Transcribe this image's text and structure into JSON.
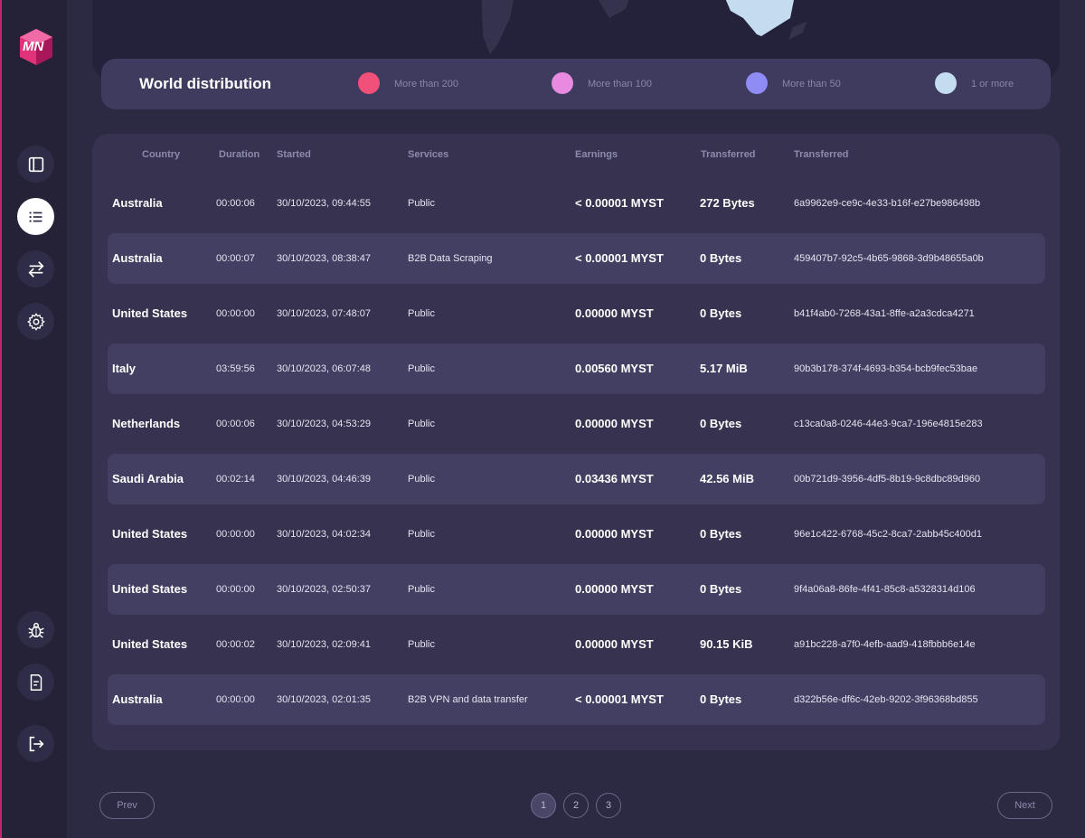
{
  "app": {
    "logo_text": "MN",
    "accent_color": "#e0337a"
  },
  "sidebar": {
    "top_items": [
      {
        "icon": "panel-layout-icon",
        "active": false
      },
      {
        "icon": "list-icon",
        "active": true
      },
      {
        "icon": "transfer-arrows-icon",
        "active": false
      },
      {
        "icon": "gear-icon",
        "active": false
      }
    ],
    "bottom_items": [
      {
        "icon": "bug-icon"
      },
      {
        "icon": "document-icon"
      },
      {
        "icon": "logout-icon"
      }
    ]
  },
  "legend": {
    "title": "World distribution",
    "items": [
      {
        "label": "More than 200",
        "color": "#f0507a"
      },
      {
        "label": "More than 100",
        "color": "#e88ae0"
      },
      {
        "label": "More than 50",
        "color": "#8f8cf5"
      },
      {
        "label": "1 or more",
        "color": "#c4dcf0"
      }
    ]
  },
  "table": {
    "headers": {
      "country": "Country",
      "duration": "Duration",
      "started": "Started",
      "services": "Services",
      "earnings": "Earnings",
      "transferred": "Transferred",
      "id": "Transferred"
    },
    "rows": [
      {
        "country": "Australia",
        "duration": "00:00:06",
        "started": "30/10/2023, 09:44:55",
        "services": "Public",
        "earnings": "< 0.00001 MYST",
        "transferred": "272 Bytes",
        "id": "6a9962e9-ce9c-4e33-b16f-e27be986498b"
      },
      {
        "country": "Australia",
        "duration": "00:00:07",
        "started": "30/10/2023, 08:38:47",
        "services": "B2B Data Scraping",
        "earnings": "< 0.00001 MYST",
        "transferred": "0 Bytes",
        "id": "459407b7-92c5-4b65-9868-3d9b48655a0b"
      },
      {
        "country": "United States",
        "duration": "00:00:00",
        "started": "30/10/2023, 07:48:07",
        "services": "Public",
        "earnings": "0.00000 MYST",
        "transferred": "0 Bytes",
        "id": "b41f4ab0-7268-43a1-8ffe-a2a3cdca4271"
      },
      {
        "country": "Italy",
        "duration": "03:59:56",
        "started": "30/10/2023, 06:07:48",
        "services": "Public",
        "earnings": "0.00560 MYST",
        "transferred": "5.17 MiB",
        "id": "90b3b178-374f-4693-b354-bcb9fec53bae"
      },
      {
        "country": "Netherlands",
        "duration": "00:00:06",
        "started": "30/10/2023, 04:53:29",
        "services": "Public",
        "earnings": "0.00000 MYST",
        "transferred": "0 Bytes",
        "id": "c13ca0a8-0246-44e3-9ca7-196e4815e283"
      },
      {
        "country": "Saudi Arabia",
        "duration": "00:02:14",
        "started": "30/10/2023, 04:46:39",
        "services": "Public",
        "earnings": "0.03436 MYST",
        "transferred": "42.56 MiB",
        "id": "00b721d9-3956-4df5-8b19-9c8dbc89d960"
      },
      {
        "country": "United States",
        "duration": "00:00:00",
        "started": "30/10/2023, 04:02:34",
        "services": "Public",
        "earnings": "0.00000 MYST",
        "transferred": "0 Bytes",
        "id": "96e1c422-6768-45c2-8ca7-2abb45c400d1"
      },
      {
        "country": "United States",
        "duration": "00:00:00",
        "started": "30/10/2023, 02:50:37",
        "services": "Public",
        "earnings": "0.00000 MYST",
        "transferred": "0 Bytes",
        "id": "9f4a06a8-86fe-4f41-85c8-a5328314d106"
      },
      {
        "country": "United States",
        "duration": "00:00:02",
        "started": "30/10/2023, 02:09:41",
        "services": "Public",
        "earnings": "0.00000 MYST",
        "transferred": "90.15 KiB",
        "id": "a91bc228-a7f0-4efb-aad9-418fbbb6e14e"
      },
      {
        "country": "Australia",
        "duration": "00:00:00",
        "started": "30/10/2023, 02:01:35",
        "services": "B2B VPN and data transfer",
        "earnings": "< 0.00001 MYST",
        "transferred": "0 Bytes",
        "id": "d322b56e-df6c-42eb-9202-3f96368bd855"
      }
    ]
  },
  "pagination": {
    "prev_label": "Prev",
    "next_label": "Next",
    "pages": [
      "1",
      "2",
      "3"
    ],
    "current": "1"
  }
}
